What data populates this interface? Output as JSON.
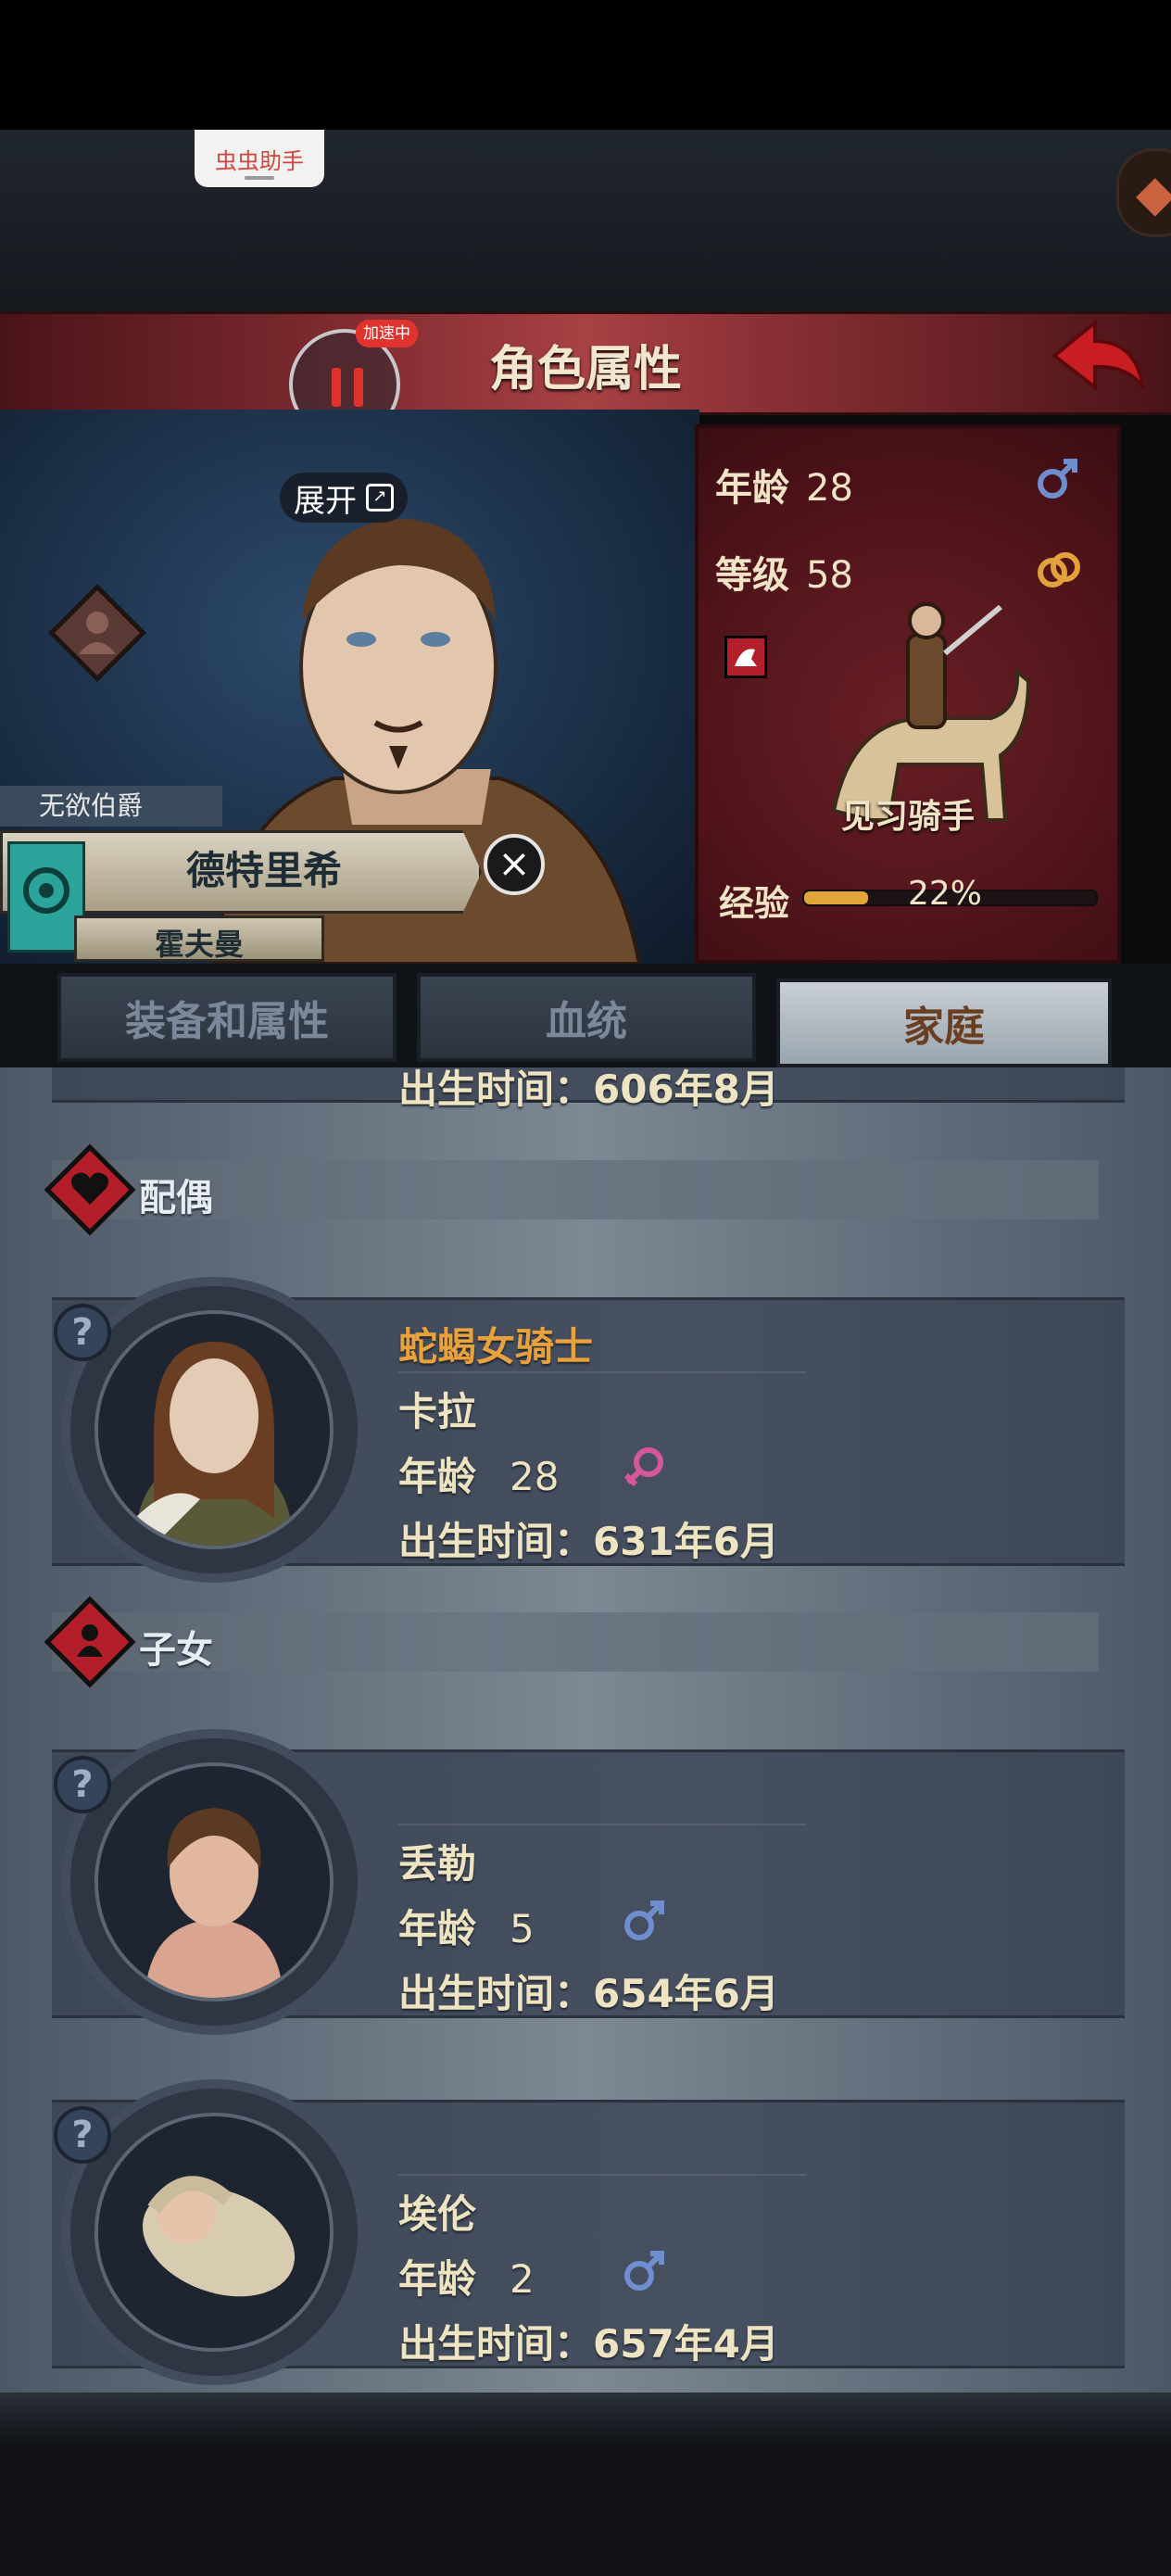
{
  "helper": {
    "label": "虫虫助手"
  },
  "header": {
    "title": "角色属性",
    "speed_badge": "加速中"
  },
  "portrait": {
    "expand_label": "展开"
  },
  "character": {
    "title": "无欲伯爵",
    "name": "德特里希",
    "surname": "霍夫曼"
  },
  "stats": {
    "age_label": "年龄",
    "age": "28",
    "level_label": "等级",
    "level": "58",
    "class_name": "见习骑手",
    "exp_label": "经验",
    "exp_percent": "22%",
    "exp_fraction": 0.22
  },
  "tabs": [
    {
      "label": "装备和属性"
    },
    {
      "label": "血统"
    },
    {
      "label": "家庭",
      "active": true
    }
  ],
  "family": {
    "partial_birth": "出生时间：606年8月",
    "spouse_section": "配偶",
    "children_section": "子女",
    "age_label": "年龄",
    "spouse": {
      "title": "蛇蝎女骑士",
      "name": "卡拉",
      "age": "28",
      "gender": "female",
      "birth": "出生时间：631年6月"
    },
    "children": [
      {
        "name": "丢勒",
        "age": "5",
        "gender": "male",
        "birth": "出生时间：654年6月"
      },
      {
        "name": "埃伦",
        "age": "2",
        "gender": "male",
        "birth": "出生时间：657年4月"
      }
    ]
  },
  "colors": {
    "accent_red": "#b31e28",
    "gold": "#e9a23b",
    "exp_fill": "#e0a43a",
    "female": "#d4579c",
    "male": "#6f8ecf"
  }
}
